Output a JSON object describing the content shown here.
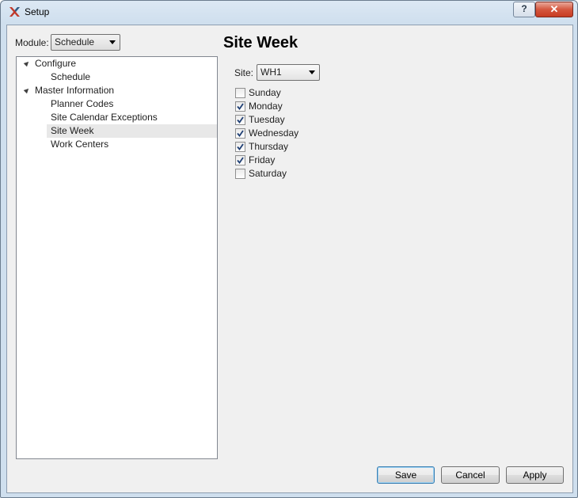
{
  "window": {
    "title": "Setup",
    "help_label": "?",
    "close_label": "✕",
    "accent_color": "#c73b22"
  },
  "module": {
    "label": "Module:",
    "selected": "Schedule"
  },
  "tree": {
    "items": [
      {
        "label": "Configure",
        "level": 0,
        "expanded": true
      },
      {
        "label": "Schedule",
        "level": 1
      },
      {
        "label": "Master Information",
        "level": 0,
        "expanded": true
      },
      {
        "label": "Planner Codes",
        "level": 1
      },
      {
        "label": "Site Calendar Exceptions",
        "level": 1
      },
      {
        "label": "Site Week",
        "level": 1,
        "selected": true
      },
      {
        "label": "Work Centers",
        "level": 1
      }
    ]
  },
  "panel": {
    "heading": "Site Week",
    "site_label": "Site:",
    "site_selected": "WH1",
    "days": [
      {
        "label": "Sunday",
        "checked": false
      },
      {
        "label": "Monday",
        "checked": true
      },
      {
        "label": "Tuesday",
        "checked": true
      },
      {
        "label": "Wednesday",
        "checked": true
      },
      {
        "label": "Thursday",
        "checked": true
      },
      {
        "label": "Friday",
        "checked": true
      },
      {
        "label": "Saturday",
        "checked": false
      }
    ]
  },
  "buttons": {
    "save": "Save",
    "cancel": "Cancel",
    "apply": "Apply"
  }
}
